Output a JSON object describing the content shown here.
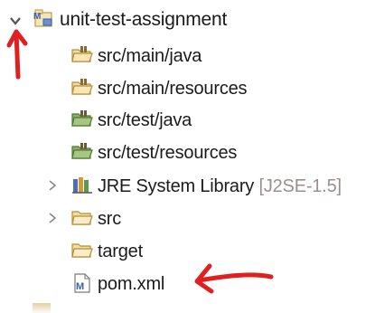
{
  "tree": {
    "root": {
      "label": "unit-test-assignment",
      "icon": "maven-project-icon",
      "expanded": true
    },
    "children": [
      {
        "label": "src/main/java",
        "icon": "source-folder-icon"
      },
      {
        "label": "src/main/resources",
        "icon": "source-folder-icon"
      },
      {
        "label": "src/test/java",
        "icon": "test-source-folder-icon"
      },
      {
        "label": "src/test/resources",
        "icon": "test-source-folder-icon"
      },
      {
        "label": "JRE System Library",
        "suffix": "[J2SE-1.5]",
        "icon": "library-icon",
        "expandable": true
      },
      {
        "label": "src",
        "icon": "folder-icon",
        "expandable": true
      },
      {
        "label": "target",
        "icon": "folder-icon"
      },
      {
        "label": "pom.xml",
        "icon": "maven-pom-file-icon"
      }
    ]
  },
  "annotations": {
    "color": "#e02020",
    "arrows": [
      "arrow-up-to-expand-toggle",
      "arrow-left-to-pom-xml"
    ]
  }
}
